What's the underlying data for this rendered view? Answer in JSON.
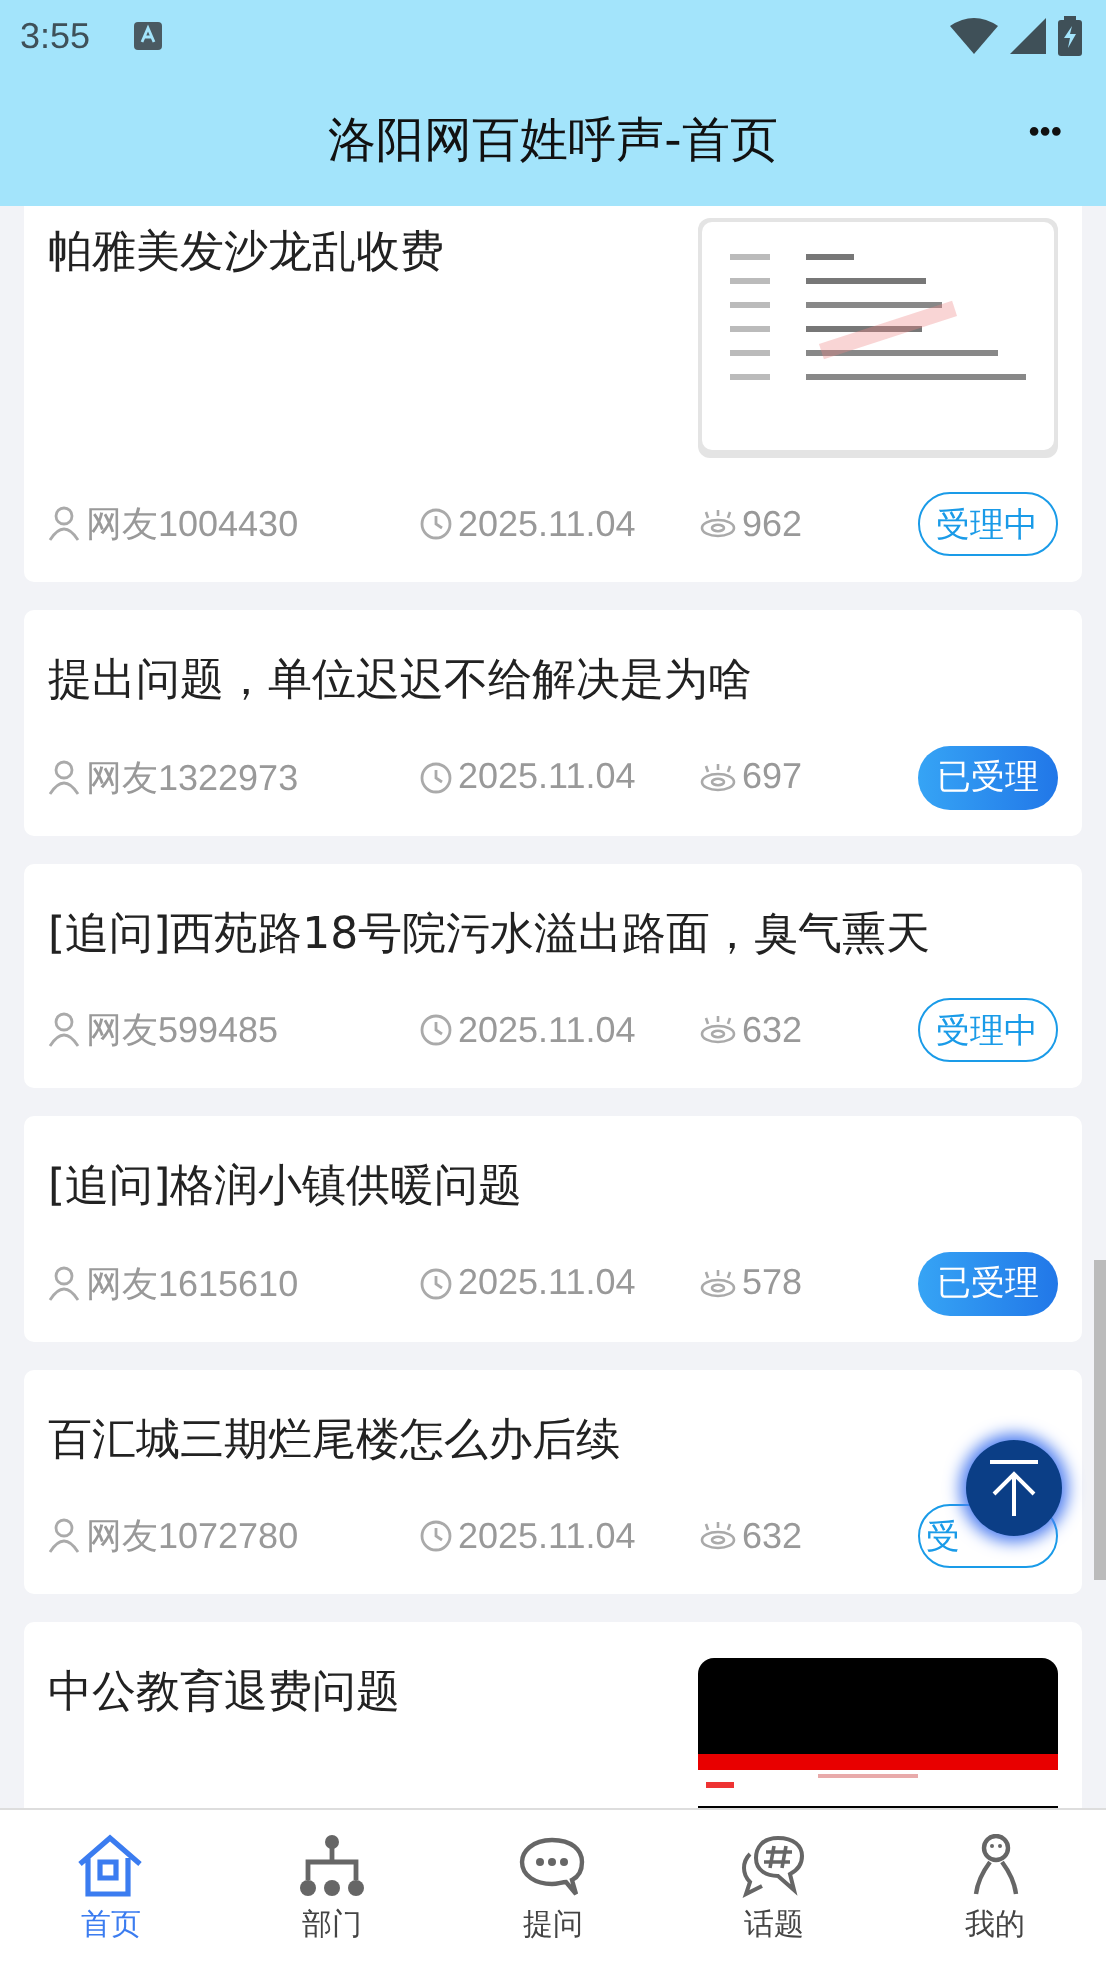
{
  "status_bar": {
    "time": "3:55"
  },
  "header": {
    "title": "洛阳网百姓呼声-首页",
    "menu": "•••"
  },
  "posts": [
    {
      "title": "帕雅美发沙龙乱收费",
      "author": "网友1004430",
      "date": "2025.11.04",
      "views": "962",
      "status": {
        "text": "受理中",
        "kind": "processing"
      }
    },
    {
      "title": "提出问题，单位迟迟不给解决是为啥",
      "author": "网友1322973",
      "date": "2025.11.04",
      "views": "697",
      "status": {
        "text": "已受理",
        "kind": "accepted"
      }
    },
    {
      "title": "[追问]西苑路18号院污水溢出路面，臭气熏天",
      "author": "网友599485",
      "date": "2025.11.04",
      "views": "632",
      "status": {
        "text": "受理中",
        "kind": "processing"
      }
    },
    {
      "title": "[追问]格润小镇供暖问题",
      "author": "网友1615610",
      "date": "2025.11.04",
      "views": "578",
      "status": {
        "text": "已受理",
        "kind": "accepted"
      }
    },
    {
      "title": "百汇城三期烂尾楼怎么办后续",
      "author": "网友1072780",
      "date": "2025.11.04",
      "views": "632",
      "status": {
        "text": "受",
        "kind": "processing"
      }
    },
    {
      "title": "中公教育退费问题"
    }
  ],
  "nav": [
    {
      "label": "首页",
      "selected": true
    },
    {
      "label": "部门",
      "selected": false
    },
    {
      "label": "提问",
      "selected": false
    },
    {
      "label": "话题",
      "selected": false
    },
    {
      "label": "我的",
      "selected": false
    }
  ]
}
